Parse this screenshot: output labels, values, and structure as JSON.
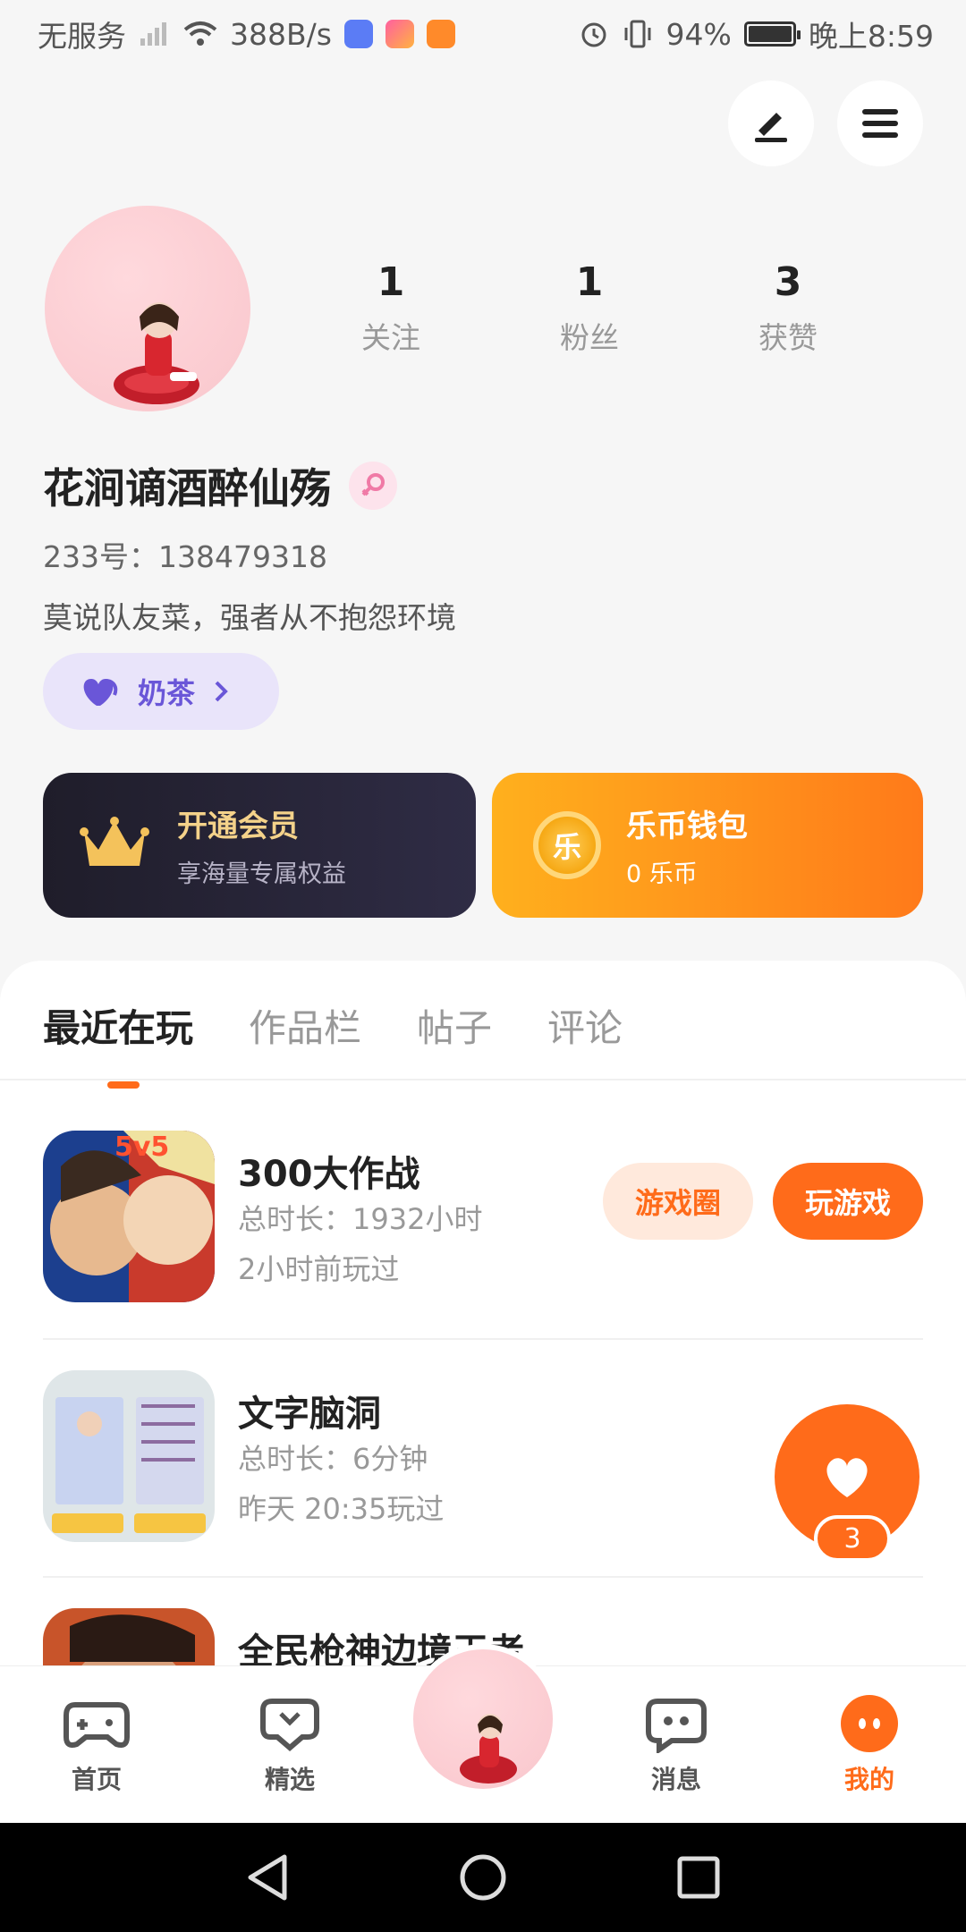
{
  "status_bar": {
    "carrier": "无服务",
    "net_speed": "388B/s",
    "battery": "94%",
    "time": "晚上8:59"
  },
  "profile": {
    "following_count": "1",
    "following_label": "关注",
    "followers_count": "1",
    "followers_label": "粉丝",
    "likes_count": "3",
    "likes_label": "获赞",
    "nickname": "花涧谪酒醉仙殇",
    "uid": "233号：138479318",
    "bio": "莫说队友菜，强者从不抱怨环境",
    "tag": "奶茶"
  },
  "cards": {
    "vip_title": "开通会员",
    "vip_sub": "享海量专属权益",
    "wallet_title": "乐币钱包",
    "wallet_sub": "0 乐币",
    "coin_char": "乐"
  },
  "tabs": [
    "最近在玩",
    "作品栏",
    "帖子",
    "评论"
  ],
  "games": [
    {
      "name": "300大作战",
      "duration": "总时长：1932小时",
      "last_played": "2小时前玩过",
      "circle_label": "游戏圈",
      "play_label": "玩游戏"
    },
    {
      "name": "文字脑洞",
      "duration": "总时长：6分钟",
      "last_played": "昨天 20:35玩过",
      "circle_label": "",
      "play_label": ""
    },
    {
      "name": "全民枪神边境王者",
      "duration": "",
      "last_played": "",
      "circle_label": "",
      "play_label": ""
    }
  ],
  "float_like": {
    "count": "3"
  },
  "bottom_nav": [
    {
      "label": "首页",
      "icon": "gamepad-icon"
    },
    {
      "label": "精选",
      "icon": "heart-bubble-icon"
    },
    {
      "label": "",
      "icon": "avatar-center"
    },
    {
      "label": "消息",
      "icon": "chat-icon"
    },
    {
      "label": "我的",
      "icon": "profile-dots-icon"
    }
  ],
  "colors": {
    "accent": "#ff6b1a",
    "vip_gold": "#f4d28a",
    "tag_purple": "#6a56d8"
  }
}
